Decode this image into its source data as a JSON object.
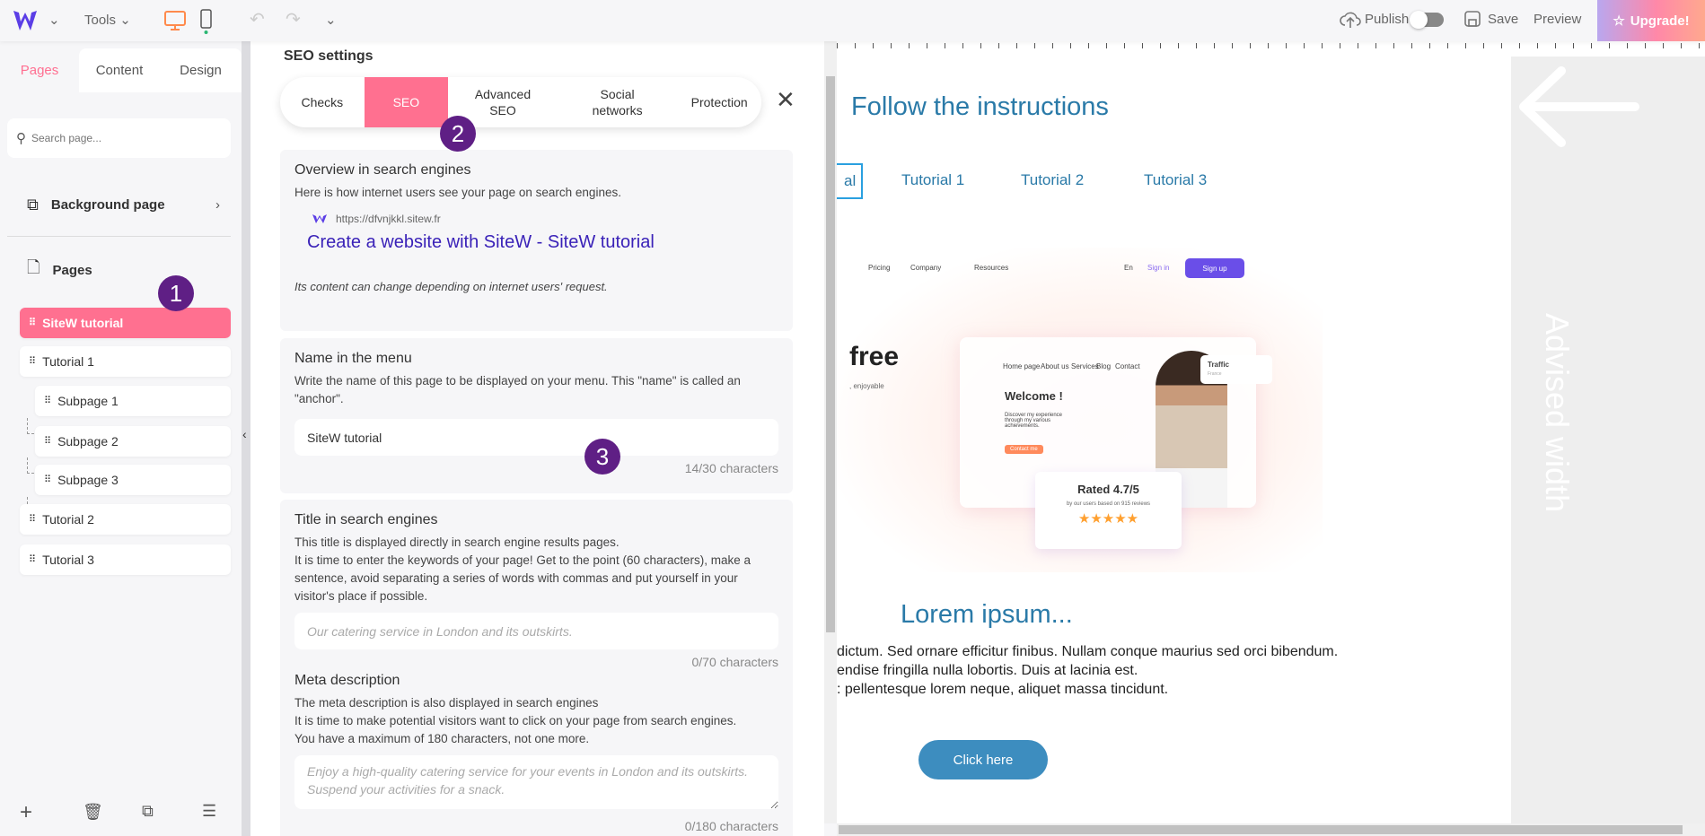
{
  "topbar": {
    "tools": "Tools",
    "publish": "Publish",
    "save": "Save",
    "preview": "Preview",
    "upgrade": "Upgrade!",
    "publish_on": false
  },
  "left": {
    "tabs": [
      "Pages",
      "Content",
      "Design"
    ],
    "search_placeholder": "Search page...",
    "background_page": "Background page",
    "pages_heading": "Pages",
    "pages": [
      {
        "label": "SiteW tutorial",
        "active": true
      },
      {
        "label": "Tutorial 1"
      },
      {
        "label": "Subpage 1",
        "sub": true
      },
      {
        "label": "Subpage 2",
        "sub": true
      },
      {
        "label": "Subpage 3",
        "sub": true
      },
      {
        "label": "Tutorial 2"
      },
      {
        "label": "Tutorial 3"
      }
    ]
  },
  "badges": [
    "1",
    "2",
    "3"
  ],
  "seo": {
    "title": "SEO settings",
    "tabs": [
      "Checks",
      "SEO",
      "Advanced SEO",
      "Social networks",
      "Protection"
    ],
    "active_tab": "SEO",
    "overview": {
      "heading": "Overview in search engines",
      "desc": "Here is how internet users see your page on search engines.",
      "url": "https://dfvnjkkl.sitew.fr",
      "link": "Create a website with SiteW - SiteW tutorial",
      "note": "Its content can change depending on internet users' request."
    },
    "menu_name": {
      "heading": "Name in the menu",
      "desc": "Write the name of this page to be displayed on your menu. This \"name\" is called an \"anchor\".",
      "value": "SiteW tutorial",
      "counter": "14/30 characters"
    },
    "search_title": {
      "heading": "Title in search engines",
      "desc1": "This title is displayed directly in search engine results pages.",
      "desc2": "It is time to enter the keywords of your page! Get to the point (60 characters), make a sentence, avoid separating a series of words with commas and put yourself in your visitor's place if possible.",
      "placeholder": "Our catering service in London and its outskirts.",
      "counter": "0/70 characters"
    },
    "meta": {
      "heading": "Meta description",
      "desc1": "The meta description is also displayed in search engines",
      "desc2": "It is time to make potential visitors want to click on your page from search engines.",
      "desc3": "You have a maximum of 180 characters, not one more.",
      "placeholder": "Enjoy a high-quality catering service for your events in London and its outskirts. Suspend your activities for a snack.",
      "counter": "0/180 characters"
    }
  },
  "canvas": {
    "heading": "Follow the instructions",
    "tabs": [
      "al",
      "Tutorial 1",
      "Tutorial 2",
      "Tutorial 3"
    ],
    "hero": {
      "nav": [
        "Pricing",
        "Company",
        "Resources"
      ],
      "lang": "En",
      "sign_in": "Sign in",
      "sign_up": "Sign up",
      "headline": "free",
      "sub": ", enjoyable",
      "mini_nav": [
        "Home page",
        "About us",
        "Services",
        "Blog",
        "Contact"
      ],
      "welcome": "Welcome !",
      "discover": "Discover my experience through my various achievements.",
      "contact": "Contact me",
      "traffic": "Traffic",
      "traffic_sub": "France",
      "rated": "Rated 4.7/5",
      "reviews": "by our users based on 915 reviews"
    },
    "lorem_title": "Lorem ipsum...",
    "lines": [
      "dictum. Sed ornare efficitur finibus. Nullam conque maurius sed orci bibendum.",
      "endise fringilla nulla lobortis. Duis at lacinia est.",
      ": pellentesque lorem neque, aliquet massa tincidunt."
    ],
    "button": "Click here",
    "advised": "Advised width"
  },
  "colors": {
    "accent": "#ff7090",
    "badge": "#5f1f85",
    "link": "#2a7aa8",
    "brand": "#5b3ee6"
  }
}
